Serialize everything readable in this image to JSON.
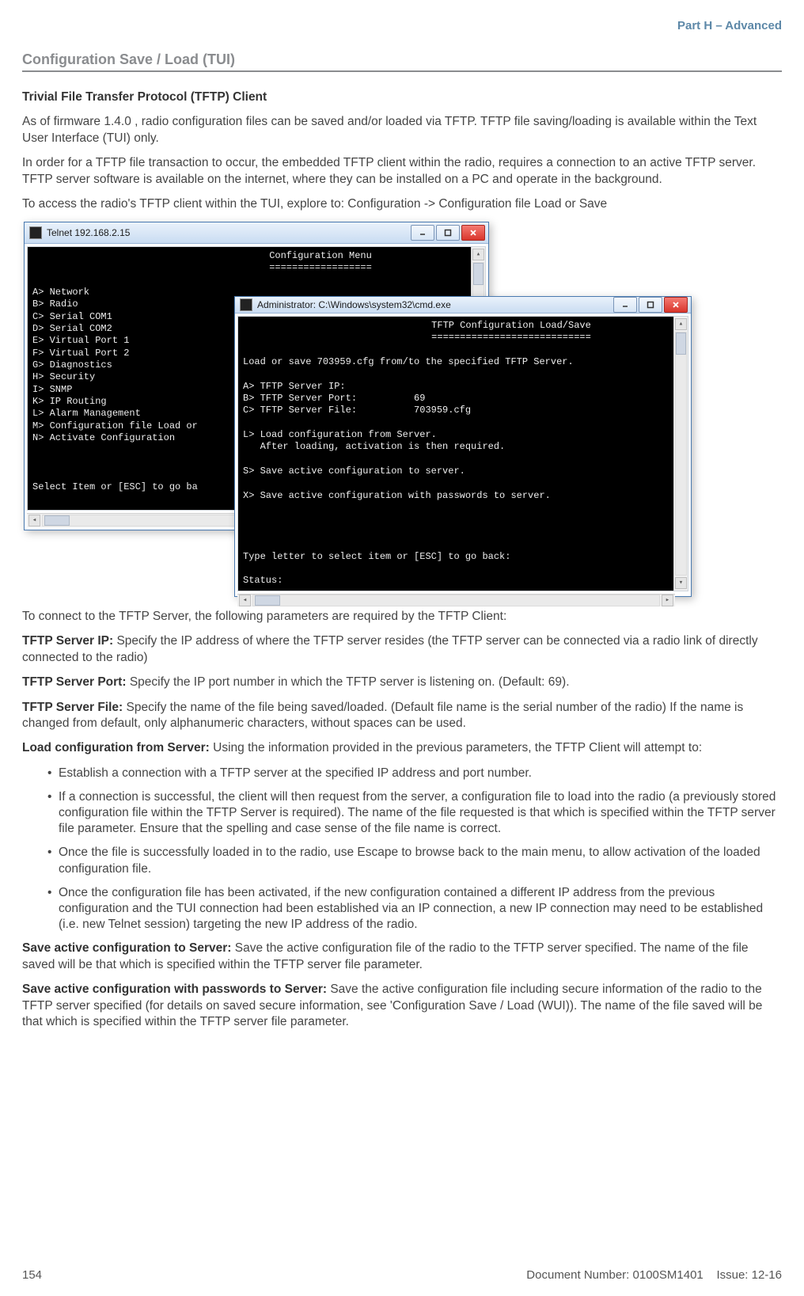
{
  "header": {
    "part": "Part H – Advanced"
  },
  "section_title": "Configuration Save / Load (TUI)",
  "intro": {
    "h": "Trivial File Transfer Protocol  (TFTP) Client",
    "p1": "As of firmware 1.4.0 , radio configuration files can be saved and/or loaded via TFTP. TFTP file saving/loading is available within the Text User Interface (TUI) only.",
    "p2": "In order for a TFTP file transaction to occur, the embedded TFTP client within the radio, requires a connection to an active TFTP server. TFTP server software is available on the internet, where they can be installed on a PC and operate in the background.",
    "p3": "To access the radio's TFTP client within the TUI, explore to: Configuration -> Configuration file Load or Save"
  },
  "win1": {
    "title": "Telnet 192.168.2.15",
    "heading": "Configuration Menu",
    "underline": "==================",
    "menu": [
      "A> Network",
      "B> Radio",
      "C> Serial COM1",
      "D> Serial COM2",
      "E> Virtual Port 1",
      "F> Virtual Port 2",
      "G> Diagnostics",
      "H> Security",
      "I> SNMP",
      "K> IP Routing",
      "L> Alarm Management",
      "M> Configuration file Load or",
      "N> Activate Configuration"
    ],
    "prompt": "Select Item or [ESC] to go ba"
  },
  "win2": {
    "title": "Administrator: C:\\Windows\\system32\\cmd.exe",
    "heading": "TFTP Configuration Load/Save",
    "underline": "============================",
    "line1": "Load or save 703959.cfg from/to the specified TFTP Server.",
    "opts": [
      "A> TFTP Server IP:",
      "B> TFTP Server Port:          69",
      "C> TFTP Server File:          703959.cfg"
    ],
    "L1": "L> Load configuration from Server.",
    "L2": "   After loading, activation is then required.",
    "S": "S> Save active configuration to server.",
    "X": "X> Save active configuration with passwords to server.",
    "prompt": "Type letter to select item or [ESC] to go back:",
    "status": "Status:"
  },
  "after": {
    "p1": "To connect to the TFTP Server, the following parameters are required by the TFTP Client:",
    "ip_label": "TFTP Server IP:",
    "ip_text": " Specify the IP address of where the TFTP server resides (the TFTP server can be connected via a radio link of directly connected to the radio)",
    "port_label": "TFTP Server Port:",
    "port_text": " Specify the IP port number in which the TFTP server is listening on. (Default: 69).",
    "file_label": "TFTP Server File:",
    "file_text": " Specify the name of the file being saved/loaded. (Default file name is the serial number of the radio) If the name is changed from default, only alphanumeric characters, without spaces can be used.",
    "load_label": "Load configuration from Server:",
    "load_text": " Using the information provided in the previous parameters, the TFTP Client will attempt to:",
    "bullets": [
      "Establish a connection with a TFTP server at the specified IP address and port number.",
      "If a connection is successful, the client will then request from the server, a configuration file to load into the radio (a previously stored configuration file within the TFTP Server is required). The name of the file requested is that which is specified within the TFTP server file parameter. Ensure that the spelling and case sense of the file name is correct.",
      "Once the file is successfully loaded in to the radio, use Escape to browse back to the main menu, to allow activation of the loaded configuration file.",
      "Once the configuration file has been activated, if the new configuration contained a different IP address from the previous configuration and the TUI connection had been established via an IP connection, a new IP connection may need to be established (i.e. new Telnet session) targeting the new IP address of the radio."
    ],
    "save_label": "Save active configuration to Server:",
    "save_text": " Save the active configuration file of the radio to the TFTP server specified. The name of the file saved will be that which is specified within the TFTP server file parameter.",
    "savep_label": "Save active configuration with passwords to Server:",
    "savep_text": " Save the active configuration file including secure information of the radio to the TFTP server specified (for details on saved secure information, see 'Configuration Save / Load (WUI)). The name of the file saved will be that which is specified within the TFTP server file parameter."
  },
  "footer": {
    "page": "154",
    "doc": "Document Number: 0100SM1401",
    "issue": "Issue: 12-16"
  }
}
